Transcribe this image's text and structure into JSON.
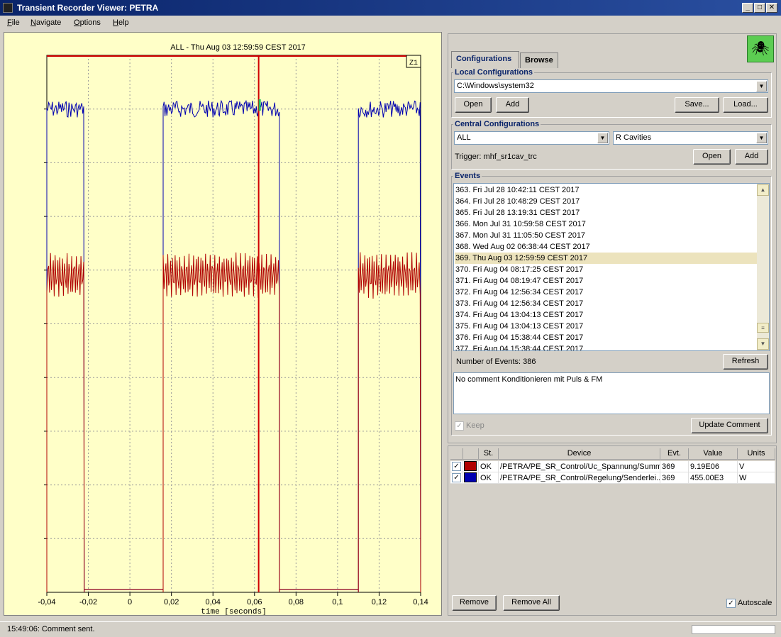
{
  "window": {
    "title": "Transient Recorder Viewer:  PETRA",
    "minimize": "_",
    "maximize": "□",
    "close": "✕"
  },
  "menu": [
    "File",
    "Navigate",
    "Options",
    "Help"
  ],
  "plot": {
    "title": "ALL - Thu Aug 03 12:59:59 CEST 2017",
    "zoom_label": "Z1",
    "xlabel": "time [seconds]",
    "cursor_x": 0.062
  },
  "chart_data": {
    "type": "line",
    "title": "ALL - Thu Aug 03 12:59:59 CEST 2017",
    "xlabel": "time [seconds]",
    "xlim": [
      -0.04,
      0.14
    ],
    "x_ticks": [
      "-0,04",
      "-0,02",
      "0",
      "0,02",
      "0,04",
      "0,06",
      "0,08",
      "0,1",
      "0,12",
      "0,14"
    ],
    "x_tick_values": [
      -0.04,
      -0.02,
      0,
      0.02,
      0.04,
      0.06,
      0.08,
      0.1,
      0.12,
      0.14
    ],
    "grid": true,
    "series": [
      {
        "color": "#0000b0",
        "segments": [
          {
            "x0": -0.04,
            "x1": -0.022,
            "level": 0.9
          },
          {
            "x0": 0.016,
            "x1": 0.072,
            "level": 0.9
          },
          {
            "x0": 0.11,
            "x1": 0.14,
            "level": 0.9
          }
        ],
        "off_level": 0.005
      },
      {
        "color": "#b00000",
        "segments": [
          {
            "x0": -0.04,
            "x1": -0.022,
            "level": 0.59
          },
          {
            "x0": 0.016,
            "x1": 0.072,
            "level": 0.59
          },
          {
            "x0": 0.11,
            "x1": 0.14,
            "level": 0.59
          }
        ],
        "off_level": 0.005
      }
    ]
  },
  "tabs": {
    "configurations": "Configurations",
    "browse": "Browse"
  },
  "local": {
    "label": "Local Configurations",
    "path": "C:\\Windows\\system32",
    "open": "Open",
    "add": "Add",
    "save": "Save...",
    "load": "Load..."
  },
  "central": {
    "label": "Central Configurations",
    "group_value": "ALL",
    "device_value": "R Cavities",
    "trigger": "Trigger: mhf_sr1cav_trc",
    "open": "Open",
    "add": "Add"
  },
  "events": {
    "label": "Events",
    "items": [
      "363. Fri Jul 28 10:42:11 CEST 2017",
      "364. Fri Jul 28 10:48:29 CEST 2017",
      "365. Fri Jul 28 13:19:31 CEST 2017",
      "366. Mon Jul 31 10:59:58 CEST 2017",
      "367. Mon Jul 31 11:05:50 CEST 2017",
      "368. Wed Aug 02 06:38:44 CEST 2017",
      "369. Thu Aug 03 12:59:59 CEST 2017",
      "370. Fri Aug 04 08:17:25 CEST 2017",
      "371. Fri Aug 04 08:19:47 CEST 2017",
      "372. Fri Aug 04 12:56:34 CEST 2017",
      "373. Fri Aug 04 12:56:34 CEST 2017",
      "374. Fri Aug 04 13:04:13 CEST 2017",
      "375. Fri Aug 04 13:04:13 CEST 2017",
      "376. Fri Aug 04 15:38:44 CEST 2017",
      "377. Fri Aug 04 15:38:44 CEST 2017"
    ],
    "selected_index": 6,
    "count_label": "Number of Events: 386",
    "refresh": "Refresh",
    "comment": "No comment Konditionieren mit Puls & FM",
    "keep": "Keep",
    "update_comment": "Update Comment"
  },
  "devices": {
    "headers": [
      "",
      "",
      "St.",
      "Device",
      "Evt.",
      "Value",
      "Units"
    ],
    "rows": [
      {
        "checked": true,
        "color": "#b00000",
        "status": "OK",
        "device": "/PETRA/PE_SR_Control/Uc_Spannung/Summe",
        "evt": "369",
        "value": "9.19E06",
        "units": "V"
      },
      {
        "checked": true,
        "color": "#0000b0",
        "status": "OK",
        "device": "/PETRA/PE_SR_Control/Regelung/Senderlei...",
        "evt": "369",
        "value": "455.00E3",
        "units": "W"
      }
    ],
    "remove": "Remove",
    "remove_all": "Remove All",
    "autoscale": "Autoscale"
  },
  "status": {
    "message": "15:49:06: Comment sent."
  }
}
